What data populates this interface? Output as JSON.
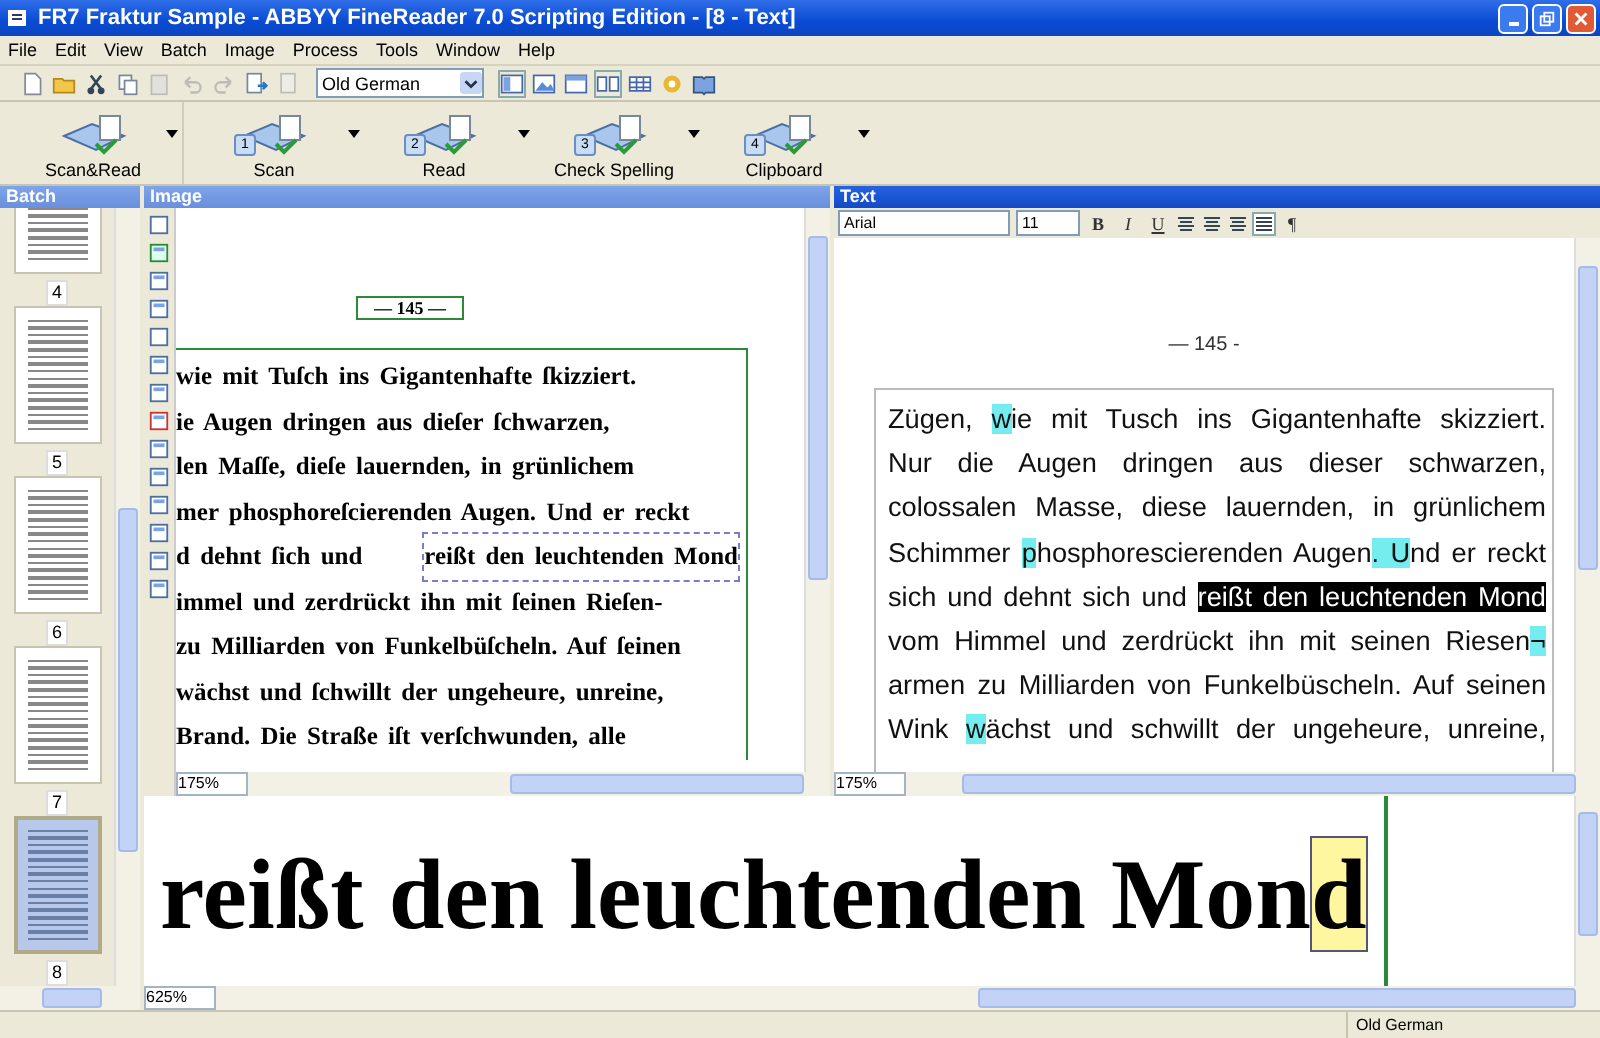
{
  "window": {
    "title": "FR7 Fraktur Sample - ABBYY FineReader 7.0 Scripting Edition - [8 - Text]"
  },
  "menu": [
    "File",
    "Edit",
    "View",
    "Batch",
    "Image",
    "Process",
    "Tools",
    "Window",
    "Help"
  ],
  "toolbar": {
    "language": "Old German"
  },
  "tasks": [
    {
      "label": "Scan&Read"
    },
    {
      "label": "Scan",
      "step": "1"
    },
    {
      "label": "Read",
      "step": "2"
    },
    {
      "label": "Check Spelling",
      "step": "3"
    },
    {
      "label": "Clipboard",
      "step": "4"
    }
  ],
  "batch": {
    "title": "Batch",
    "pages": [
      {
        "label": "4",
        "selected": false
      },
      {
        "label": "5",
        "selected": false
      },
      {
        "label": "6",
        "selected": false
      },
      {
        "label": "7",
        "selected": false
      },
      {
        "label": "8",
        "selected": true
      }
    ]
  },
  "image": {
    "title": "Image",
    "page_number": "— 145 —",
    "zoom": "175%",
    "lines": [
      [
        {
          "t": "wie mit Tuſch ins Gigantenhafte ſkizziert.",
          "selected": false
        }
      ],
      [
        {
          "t": "ie Augen dringen aus dieſer ſchwarzen,",
          "selected": false
        }
      ],
      [
        {
          "t": "len Maſſe, dieſe lauernden, in grünlichem",
          "selected": false
        }
      ],
      [
        {
          "t": "mer phosphoreſcierenden Augen. Und er reckt",
          "selected": false
        }
      ],
      [
        {
          "t": "d dehnt ſich und",
          "selected": false
        },
        {
          "t": "reißt den leuchtenden Mond",
          "selected": true
        }
      ],
      [
        {
          "t": "immel und zerdrückt ihn mit ſeinen Rieſen-",
          "selected": false
        }
      ],
      [
        {
          "t": "zu Milliarden von Funkelbüſcheln. Auf ſeinen",
          "selected": false
        }
      ],
      [
        {
          "t": "wächst und ſchwillt der ungeheure, unreine,",
          "selected": false
        }
      ],
      [
        {
          "t": "Brand. Die Straße iſt verſchwunden, alle",
          "selected": false
        }
      ]
    ]
  },
  "text": {
    "title": "Text",
    "font": "Arial",
    "size": "11",
    "format_buttons": [
      "B",
      "I",
      "U"
    ],
    "paragraph_mark": "¶",
    "page_number": "— 145 -",
    "zoom": "175%",
    "lines": [
      [
        {
          "t": "Zügen, ",
          "uncertain": false,
          "selected": false
        },
        {
          "t": "w",
          "uncertain": true,
          "selected": false
        },
        {
          "t": "ie mit Tusch ins Gigantenhafte skizziert.",
          "uncertain": false,
          "selected": false
        }
      ],
      [
        {
          "t": "Nur die Augen dringen aus dieser schwarzen,",
          "uncertain": false,
          "selected": false
        }
      ],
      [
        {
          "t": "colossalen Masse, diese lauernden, in grünlichem",
          "uncertain": false,
          "selected": false
        }
      ],
      [
        {
          "t": "Schimmer ",
          "uncertain": false,
          "selected": false
        },
        {
          "t": "p",
          "uncertain": true,
          "selected": false
        },
        {
          "t": "hosphorescierenden Augen",
          "uncertain": false,
          "selected": false
        },
        {
          "t": ". ",
          "uncertain": true,
          "selected": false
        },
        {
          "t": "U",
          "uncertain": true,
          "selected": false
        },
        {
          "t": "nd er reckt",
          "uncertain": false,
          "selected": false
        }
      ],
      [
        {
          "t": "sich und dehnt sich und ",
          "uncertain": false,
          "selected": false
        },
        {
          "t": "reißt den leuchtenden Mond",
          "uncertain": false,
          "selected": true
        }
      ],
      [
        {
          "t": "vom Himmel und zerdrückt ihn mit seinen Riesen",
          "uncertain": false,
          "selected": false
        },
        {
          "t": "¬",
          "uncertain": true,
          "selected": false
        }
      ],
      [
        {
          "t": "armen zu Milliarden von Funkelbüscheln. Auf seinen",
          "uncertain": false,
          "selected": false
        }
      ],
      [
        {
          "t": "Wink ",
          "uncertain": false,
          "selected": false
        },
        {
          "t": "w",
          "uncertain": true,
          "selected": false
        },
        {
          "t": "ächst und schwillt der ungeheure, unreine,",
          "uncertain": false,
          "selected": false
        }
      ]
    ]
  },
  "zoom_view": {
    "zoom": "625%",
    "segments": [
      {
        "t": "reißt den leuchtenden Mon",
        "current": false
      },
      {
        "t": "d",
        "current": true
      }
    ]
  },
  "status_bar": {
    "language": "Old German"
  }
}
